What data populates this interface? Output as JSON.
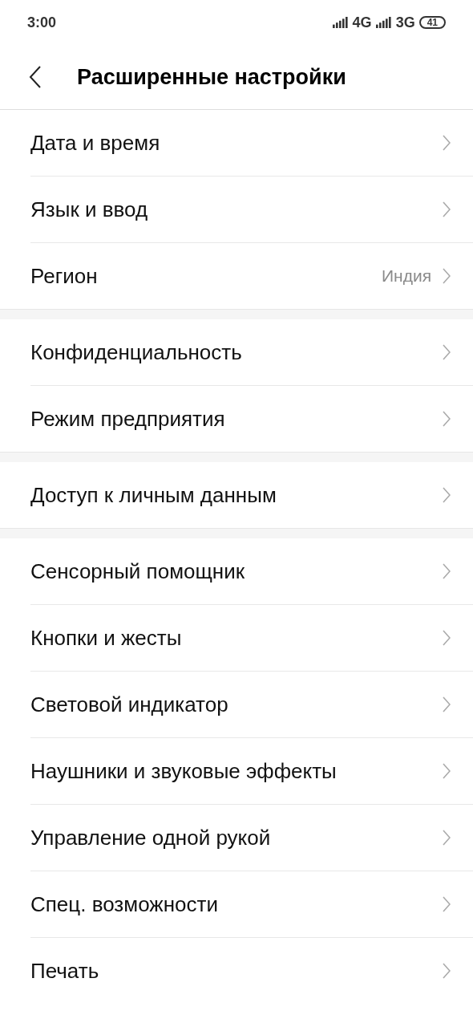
{
  "status_bar": {
    "time": "3:00",
    "network_1": "4G",
    "network_2": "3G",
    "battery": "41"
  },
  "header": {
    "title": "Расширенные настройки"
  },
  "groups": [
    {
      "items": [
        {
          "label": "Дата и время"
        },
        {
          "label": "Язык и ввод"
        },
        {
          "label": "Регион",
          "value": "Индия"
        }
      ]
    },
    {
      "items": [
        {
          "label": "Конфиденциальность"
        },
        {
          "label": "Режим предприятия"
        }
      ]
    },
    {
      "items": [
        {
          "label": "Доступ к личным данным"
        }
      ]
    },
    {
      "items": [
        {
          "label": "Сенсорный помощник"
        },
        {
          "label": "Кнопки и жесты"
        },
        {
          "label": "Световой индикатор"
        },
        {
          "label": "Наушники и звуковые эффекты"
        },
        {
          "label": "Управление одной рукой"
        },
        {
          "label": "Спец. возможности"
        },
        {
          "label": "Печать"
        }
      ]
    }
  ]
}
